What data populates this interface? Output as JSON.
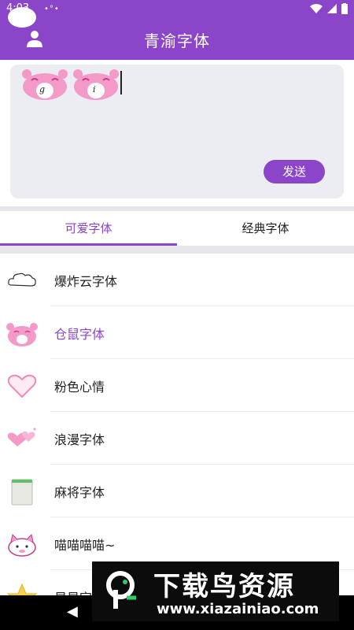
{
  "status_bar": {
    "time": "4:03",
    "dots": "•°•"
  },
  "header": {
    "title": "青渝字体",
    "user_icon": "user-icon"
  },
  "compose": {
    "chars": [
      "g",
      "i"
    ],
    "send_label": "发送"
  },
  "tabs": [
    {
      "label": "可爱字体",
      "active": true
    },
    {
      "label": "经典字体",
      "active": false
    }
  ],
  "fonts": [
    {
      "label": "爆炸云字体",
      "icon": "cloud-icon"
    },
    {
      "label": "仓鼠字体",
      "icon": "hamster-icon",
      "selected": true
    },
    {
      "label": "粉色心情",
      "icon": "heart-icon"
    },
    {
      "label": "浪漫字体",
      "icon": "romantic-hearts-icon"
    },
    {
      "label": "麻将字体",
      "icon": "mahjong-tile-icon"
    },
    {
      "label": "喵喵喵喵~",
      "icon": "cat-icon"
    },
    {
      "label": "星星字",
      "icon": "star-icon"
    }
  ],
  "watermark": {
    "title": "下载鸟资源",
    "url": "www.xiazainiao.com"
  },
  "colors": {
    "accent": "#8a45c8",
    "pink": "#f49ac8"
  }
}
